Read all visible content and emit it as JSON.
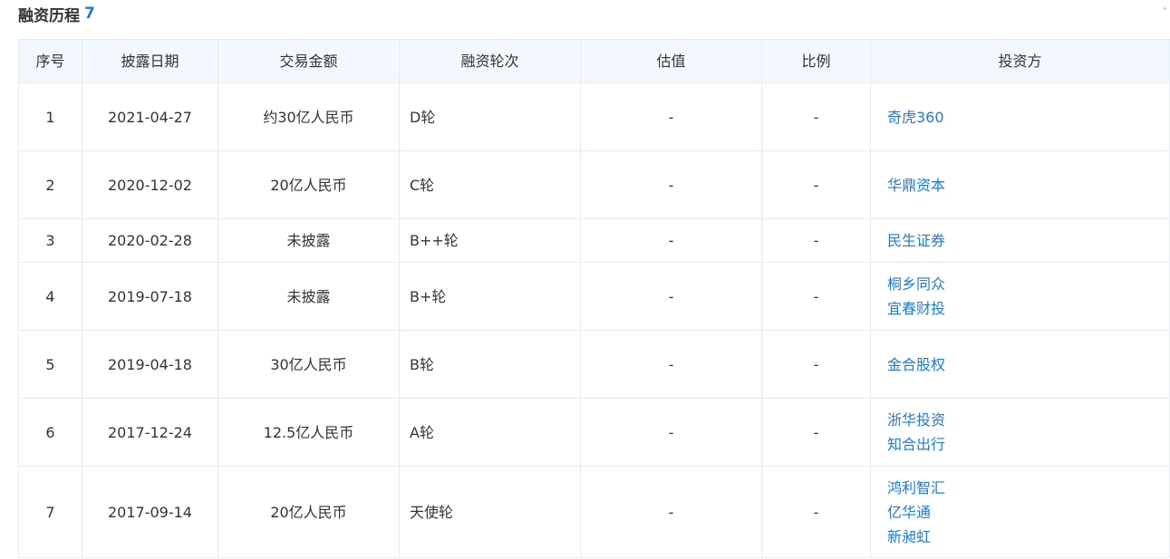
{
  "section": {
    "title": "融资历程",
    "count": "7"
  },
  "table": {
    "headers": [
      "序号",
      "披露日期",
      "交易金额",
      "融资轮次",
      "估值",
      "比例",
      "投资方"
    ],
    "rows": [
      {
        "index": "1",
        "date": "2021-04-27",
        "amount": "约30亿人民币",
        "round": "D轮",
        "valuation": "-",
        "ratio": "-",
        "investors": [
          "奇虎360"
        ]
      },
      {
        "index": "2",
        "date": "2020-12-02",
        "amount": "20亿人民币",
        "round": "C轮",
        "valuation": "-",
        "ratio": "-",
        "investors": [
          "华鼎资本"
        ]
      },
      {
        "index": "3",
        "date": "2020-02-28",
        "amount": "未披露",
        "round": "B++轮",
        "valuation": "-",
        "ratio": "-",
        "investors": [
          "民生证券"
        ]
      },
      {
        "index": "4",
        "date": "2019-07-18",
        "amount": "未披露",
        "round": "B+轮",
        "valuation": "-",
        "ratio": "-",
        "investors": [
          "桐乡同众",
          "宜春财投"
        ]
      },
      {
        "index": "5",
        "date": "2019-04-18",
        "amount": "30亿人民币",
        "round": "B轮",
        "valuation": "-",
        "ratio": "-",
        "investors": [
          "金合股权"
        ]
      },
      {
        "index": "6",
        "date": "2017-12-24",
        "amount": "12.5亿人民币",
        "round": "A轮",
        "valuation": "-",
        "ratio": "-",
        "investors": [
          "浙华投资",
          "知合出行"
        ]
      },
      {
        "index": "7",
        "date": "2017-09-14",
        "amount": "20亿人民币",
        "round": "天使轮",
        "valuation": "-",
        "ratio": "-",
        "investors": [
          "鸿利智汇",
          "亿华通",
          "新昶虹"
        ]
      }
    ]
  },
  "colors": {
    "accent": "#1d7ad9",
    "header_bg": "#f2f8fd",
    "border": "#e4ebf2",
    "text": "#333333"
  }
}
